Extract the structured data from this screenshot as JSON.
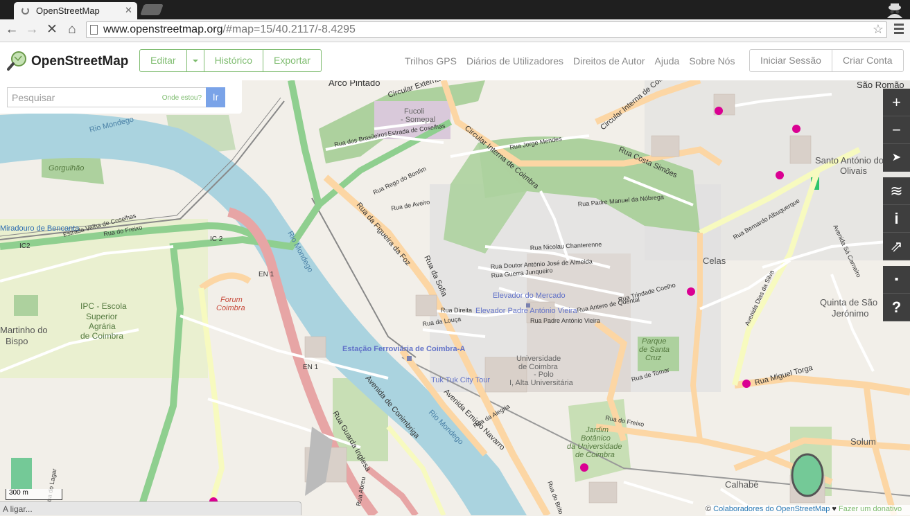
{
  "browser": {
    "tab_title": "OpenStreetMap",
    "tab_close": "✕",
    "url_host": "www.openstreetmap.org",
    "url_path": "/#map=15/40.2117/-8.4295",
    "back_icon": "←",
    "forward_icon": "→",
    "stop_icon": "✕",
    "home_icon": "⌂",
    "star_icon": "☆"
  },
  "header": {
    "brand": "OpenStreetMap",
    "edit": "Editar",
    "history": "Histórico",
    "export": "Exportar",
    "links": [
      "Trilhos GPS",
      "Diários de Utilizadores",
      "Direitos de Autor",
      "Ajuda",
      "Sobre Nós"
    ],
    "login": "Iniciar Sessão",
    "signup": "Criar Conta",
    "accent": "#7ebc6f"
  },
  "search": {
    "placeholder": "Pesquisar",
    "where_am_i": "Onde estou?",
    "go": "Ir"
  },
  "map": {
    "center": "40.2117/-8.4295",
    "zoom": 15,
    "controls": [
      "+",
      "−",
      "➤",
      "≋",
      "i",
      "⇗",
      "▪",
      "?"
    ],
    "scale": "300 m",
    "attribution_prefix": "©",
    "attribution_link": "Colaboradores do OpenStreetMap",
    "attribution_heart": "♥",
    "attribution_donate": "Fazer um donativo",
    "labels": {
      "arco_pintado": "Arco Pintado",
      "sao_romao": "São Romão",
      "circular_externa": "Circular Externa",
      "fucoli": "Fucoli",
      "somepal": "- Somepal",
      "rio_mondego_1": "Rio Mondego",
      "rio_mondego_2": "Rio Mondego",
      "rio_mondego_3": "Rio Mondego",
      "gorgulhao": "Gorgulhão",
      "circular_interna_1": "Circular Interna de Coimbra",
      "circular_interna_2": "Circular Interna de Coimbra",
      "rua_costa_simoes": "Rua Costa Simões",
      "santo_antonio_1": "Santo António dos",
      "santo_antonio_2": "Olivais",
      "miradouro": "Miradouro de Bencanta",
      "ic2_1": "IC2",
      "ic2_2": "IC 2",
      "en1_1": "EN 1",
      "en1_2": "EN 1",
      "rua_figueira": "Rua da Figueira da Foz",
      "rua_sofia": "Rua da Sofia",
      "elevador_mercado": "Elevador do Mercado",
      "elevador_padre": "Elevador Padre António Vieira",
      "celas": "Celas",
      "ipc_1": "IPC - Escola",
      "ipc_2": "Superior",
      "ipc_3": "Agrária",
      "ipc_4": "de Coimbra",
      "martinho_1": "Martinho do",
      "martinho_2": "Bispo",
      "forum_1": "Forum",
      "forum_2": "Coimbra",
      "estacao": "Estação Ferroviária de Coimbra-A",
      "quinta_1": "Quinta de São",
      "quinta_2": "Jerónimo",
      "parque_1": "Parque",
      "parque_2": "de Santa",
      "parque_3": "Cruz",
      "universidade_1": "Universidade",
      "universidade_2": "de Coimbra",
      "universidade_3": "- Polo",
      "universidade_4": "I, Alta Universitária",
      "tuk_tuk": "Tuk Tuk City Tour",
      "rua_miguel_torga": "Rua Miguel Torga",
      "avenida_emidio": "Avenida Emídio Navarro",
      "jardim_1": "Jardim",
      "jardim_2": "Botânico",
      "jardim_3": "da Universidade",
      "jardim_4": "de Coimbra",
      "solum": "Solum",
      "calhabe": "Calhabé",
      "rua_guarda_inglesa": "Rua Guarda Inglesa",
      "avenida_conimbriga": "Avenida de Conimbriga",
      "rua_jorge_mendes": "Rua Jorge Mendes",
      "rua_brasileiros": "Rua dos Brasileiros",
      "estrada_coselhas": "Estrada de Coselhas",
      "estrada_velha_coselhas": "Estrada Velha de Coselhas",
      "rua_freixo": "Rua do Freixo",
      "rua_bernardo": "Rua Bernardo Albuquerque",
      "rua_padre_manuel": "Rua Padre Manuel da Nóbrega",
      "rua_doutor_antonio": "Rua Doutor António José de Almeida",
      "rua_guerra_junqueiro": "Rua Guerra Junqueiro",
      "rua_nicolau": "Rua Nicolau Chanterenne",
      "rua_trindade": "Rua Trindade Coelho",
      "rua_antero": "Rua Antero de Quental",
      "rua_padre_antonio": "Rua Padre António Vieira",
      "rua_direita": "Rua Direita",
      "rua_louca": "Rua da Louça",
      "rua_aveiro": "Rua de Aveiro",
      "rua_bonfim": "Rua Rego do Bonfim",
      "avenida_sa_carneiro": "Avenida Sá Carneiro",
      "avenida_dias_silva": "Avenida Dias da Silva",
      "rua_lagar": "Rua do Lagar",
      "rua_abreu": "Rua Abreu",
      "rua_brito": "Rua do Brito",
      "rua_tomar": "Rua de Tomar",
      "rua_alegria": "Rua da Alegria",
      "rua_freixo_2": "Rua do Freixo"
    }
  },
  "status": {
    "loading": "A ligar..."
  }
}
